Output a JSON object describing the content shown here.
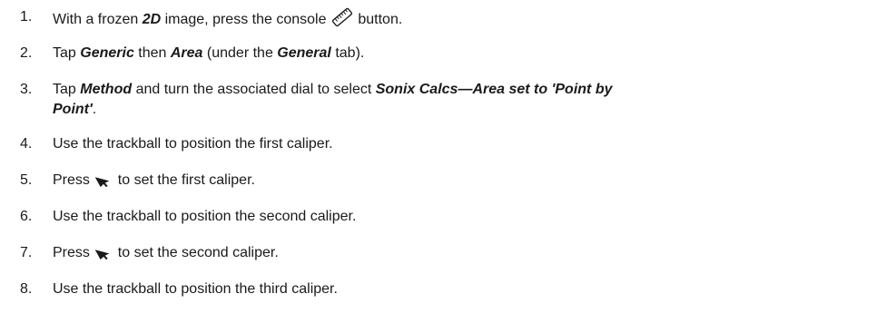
{
  "steps": [
    {
      "number": "1.",
      "parts": {
        "a": "With a frozen ",
        "b": "2D",
        "c": " image, press the console ",
        "icon": "ruler-icon",
        "d": " button."
      }
    },
    {
      "number": "2.",
      "parts": {
        "a": "Tap ",
        "b": "Generic",
        "c": " then ",
        "d": "Area",
        "e": " (under the ",
        "f": "General",
        "g": " tab)."
      }
    },
    {
      "number": "3.",
      "parts": {
        "a": "Tap ",
        "b": "Method",
        "c": " and turn the associated dial to select ",
        "d": "Sonix Calcs—Area set to 'Point by",
        "e": "Point'",
        "f": "."
      }
    },
    {
      "number": "4.",
      "text": "Use the trackball to position the first caliper."
    },
    {
      "number": "5.",
      "parts": {
        "a": "Press ",
        "icon": "pointer-arrow-icon",
        "b": " to set the first caliper."
      }
    },
    {
      "number": "6.",
      "text": "Use the trackball to position the second caliper."
    },
    {
      "number": "7.",
      "parts": {
        "a": "Press ",
        "icon": "pointer-arrow-icon",
        "b": " to set the second caliper."
      }
    },
    {
      "number": "8.",
      "text": "Use the trackball to position the third caliper."
    }
  ]
}
